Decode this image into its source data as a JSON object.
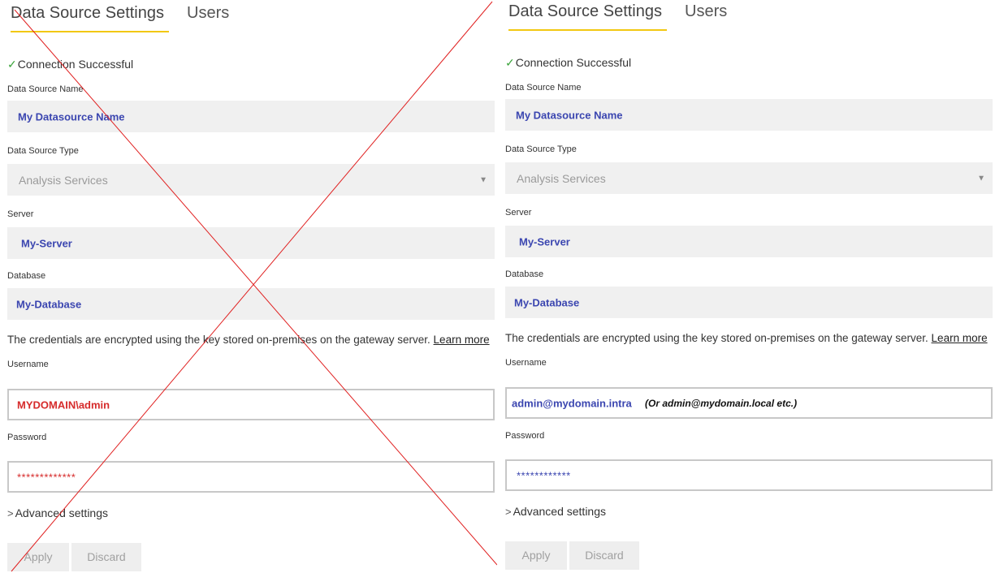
{
  "tabs": [
    {
      "label": "Data Source Settings"
    },
    {
      "label": "Users"
    }
  ],
  "status_text": "Connection Successful",
  "labels": {
    "name": "Data Source Name",
    "type": "Data Source Type",
    "server": "Server",
    "database": "Database",
    "username": "Username",
    "password": "Password"
  },
  "datasource_name": "My Datasource Name",
  "datasource_type": "Analysis Services",
  "server": "My-Server",
  "database": "My-Database",
  "credentials_text": "The credentials are encrypted using the key stored on-premises on the gateway server.",
  "learn_more": "Learn more",
  "advanced_settings": "Advanced settings",
  "buttons": {
    "apply": "Apply",
    "discard": "Discard"
  },
  "left": {
    "username": "MYDOMAIN\\admin",
    "password": "*************"
  },
  "right": {
    "username": "admin@mydomain.intra",
    "username_note": "(Or admin@mydomain.local etc.)",
    "password": "************"
  },
  "colors": {
    "accent_underline": "#f2c811",
    "value_blue": "#3b46b0",
    "value_red": "#d62b2b",
    "cross_red": "#e02020",
    "check_green": "#3ca43c"
  },
  "icons": [
    "check-icon",
    "chevron-down-icon",
    "chevron-right-icon"
  ]
}
